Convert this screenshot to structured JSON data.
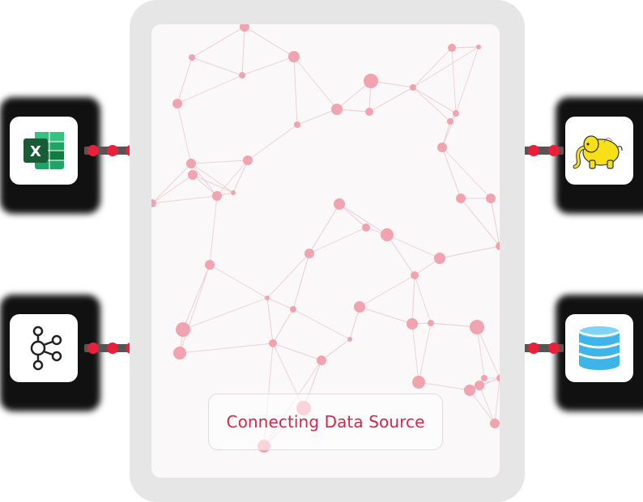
{
  "status": {
    "label": "Connecting Data Source"
  },
  "sources": {
    "left": [
      {
        "name": "excel",
        "icon": "excel-icon"
      },
      {
        "name": "kafka",
        "icon": "kafka-icon"
      }
    ],
    "right": [
      {
        "name": "hadoop",
        "icon": "hadoop-icon"
      },
      {
        "name": "database",
        "icon": "database-icon"
      }
    ]
  },
  "colors": {
    "accent": "#e8203a",
    "node": "#f2a3b0",
    "text_accent": "#d8254a",
    "excel_green": "#1e7145",
    "hadoop_yellow": "#f7e017",
    "db_blue": "#3db5e8"
  }
}
